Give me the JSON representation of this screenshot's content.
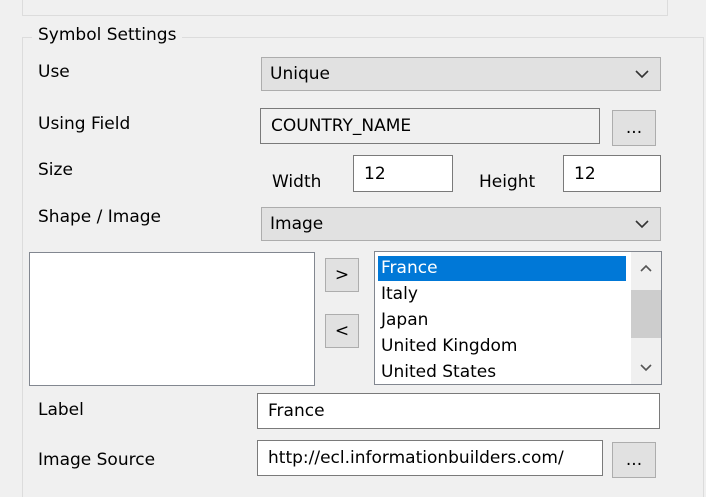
{
  "group_title": "Symbol Settings",
  "use": {
    "label": "Use",
    "value": "Unique"
  },
  "using_field": {
    "label": "Using Field",
    "value": "COUNTRY_NAME",
    "browse_label": "..."
  },
  "size": {
    "label": "Size",
    "width_label": "Width",
    "width_value": "12",
    "height_label": "Height",
    "height_value": "12"
  },
  "shape": {
    "label": "Shape / Image",
    "value": "Image"
  },
  "transfer": {
    "add_label": ">",
    "remove_label": "<"
  },
  "values_list": {
    "items": [
      "France",
      "Italy",
      "Japan",
      "United Kingdom",
      "United States"
    ],
    "selected": "France"
  },
  "label_field": {
    "label": "Label",
    "value": "France"
  },
  "image_source": {
    "label": "Image Source",
    "value": "http://ecl.informationbuilders.com/",
    "browse_label": "..."
  },
  "icons": {
    "dropdown": "chevron-down-icon",
    "scroll_up": "scroll-up-arrow-icon",
    "scroll_down": "scroll-down-arrow-icon"
  },
  "colors": {
    "selection": "#0078d7",
    "background": "#f0f0f0"
  }
}
